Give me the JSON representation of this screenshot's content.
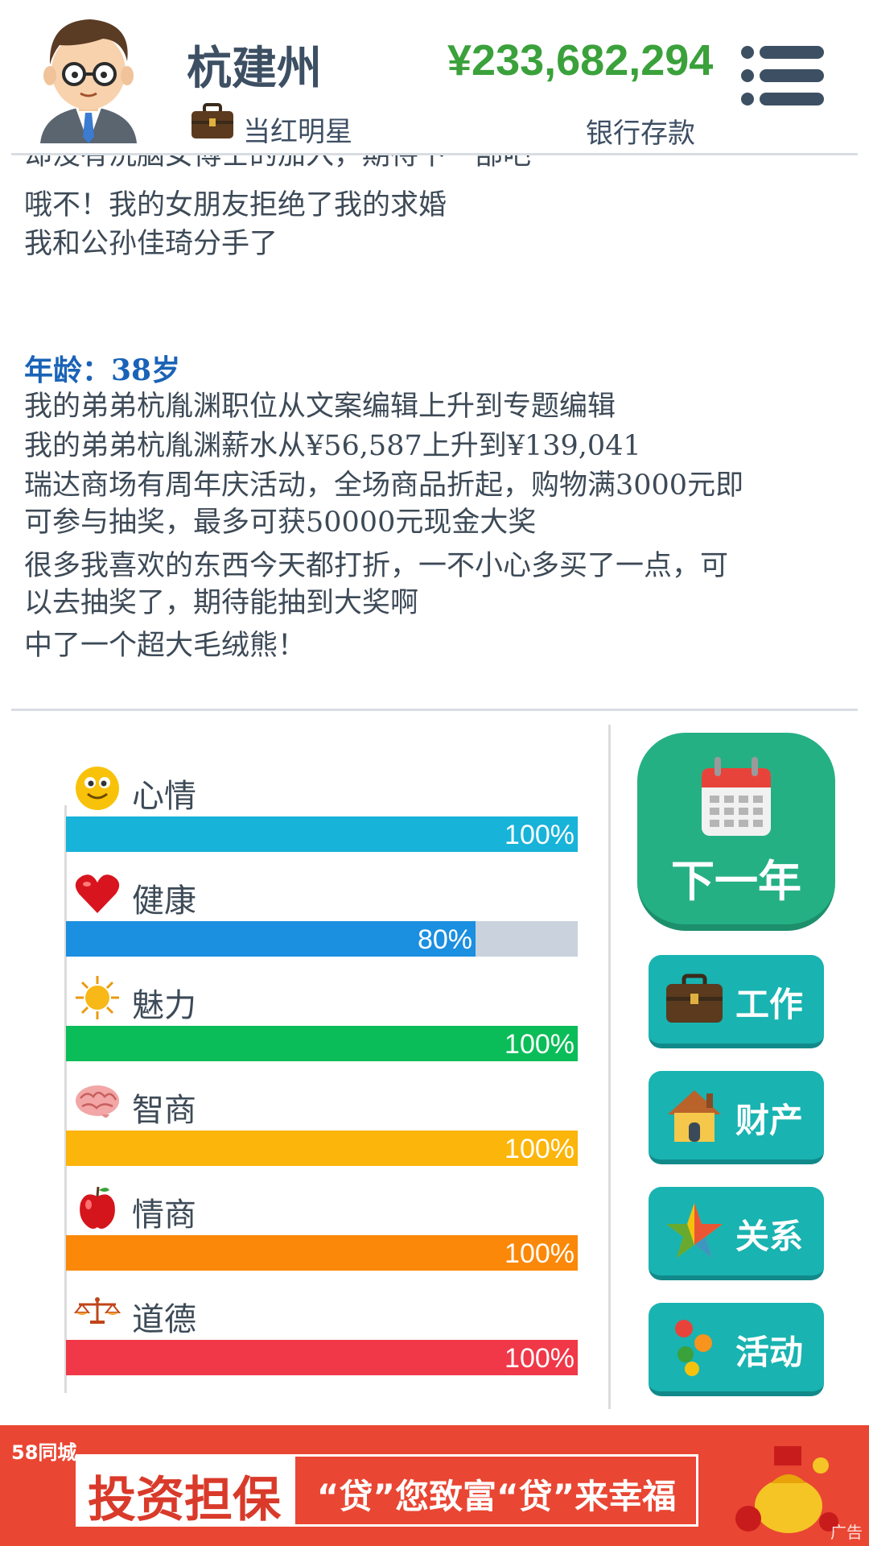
{
  "header": {
    "name": "杭建州",
    "job": "当红明星",
    "money": "¥233,682,294",
    "money_label": "银行存款"
  },
  "log": {
    "partial_line": "却没有洗脑女博士的加入，期待下一部吧",
    "lines_before": [
      "哦不！我的女朋友拒绝了我的求婚",
      "我和公孙佳琦分手了"
    ],
    "age_title": "年龄：38岁",
    "lines_after": [
      "我的弟弟杭胤渊职位从文案编辑上升到专题编辑",
      "我的弟弟杭胤渊薪水从¥56,587上升到¥139,041",
      "瑞达商场有周年庆活动，全场商品折起，购物满3000元即",
      "可参与抽奖，最多可获50000元现金大奖",
      "很多我喜欢的东西今天都打折，一不小心多买了一点，可",
      "以去抽奖了，期待能抽到大奖啊",
      "中了一个超大毛绒熊！"
    ]
  },
  "stats": [
    {
      "label": "心情",
      "value": 1.0,
      "pct": "100%",
      "color": "#17b3d9",
      "icon": "smiley-icon"
    },
    {
      "label": "健康",
      "value": 0.8,
      "pct": "80%",
      "color": "#1b8fe0",
      "icon": "heart-icon"
    },
    {
      "label": "魅力",
      "value": 1.0,
      "pct": "100%",
      "color": "#0bbd58",
      "icon": "sun-icon"
    },
    {
      "label": "智商",
      "value": 1.0,
      "pct": "100%",
      "color": "#fcb50a",
      "icon": "brain-icon"
    },
    {
      "label": "情商",
      "value": 1.0,
      "pct": "100%",
      "color": "#fb8808",
      "icon": "apple-icon"
    },
    {
      "label": "道德",
      "value": 1.0,
      "pct": "100%",
      "color": "#f03848",
      "icon": "scales-icon"
    }
  ],
  "buttons": {
    "next_year": "下一年",
    "work": "工作",
    "property": "财产",
    "relations": "关系",
    "activity": "活动"
  },
  "ad": {
    "brand": "58同城",
    "main": "投资担保",
    "slogan": "“贷”您致富“贷”来幸福",
    "tag": "广告"
  }
}
